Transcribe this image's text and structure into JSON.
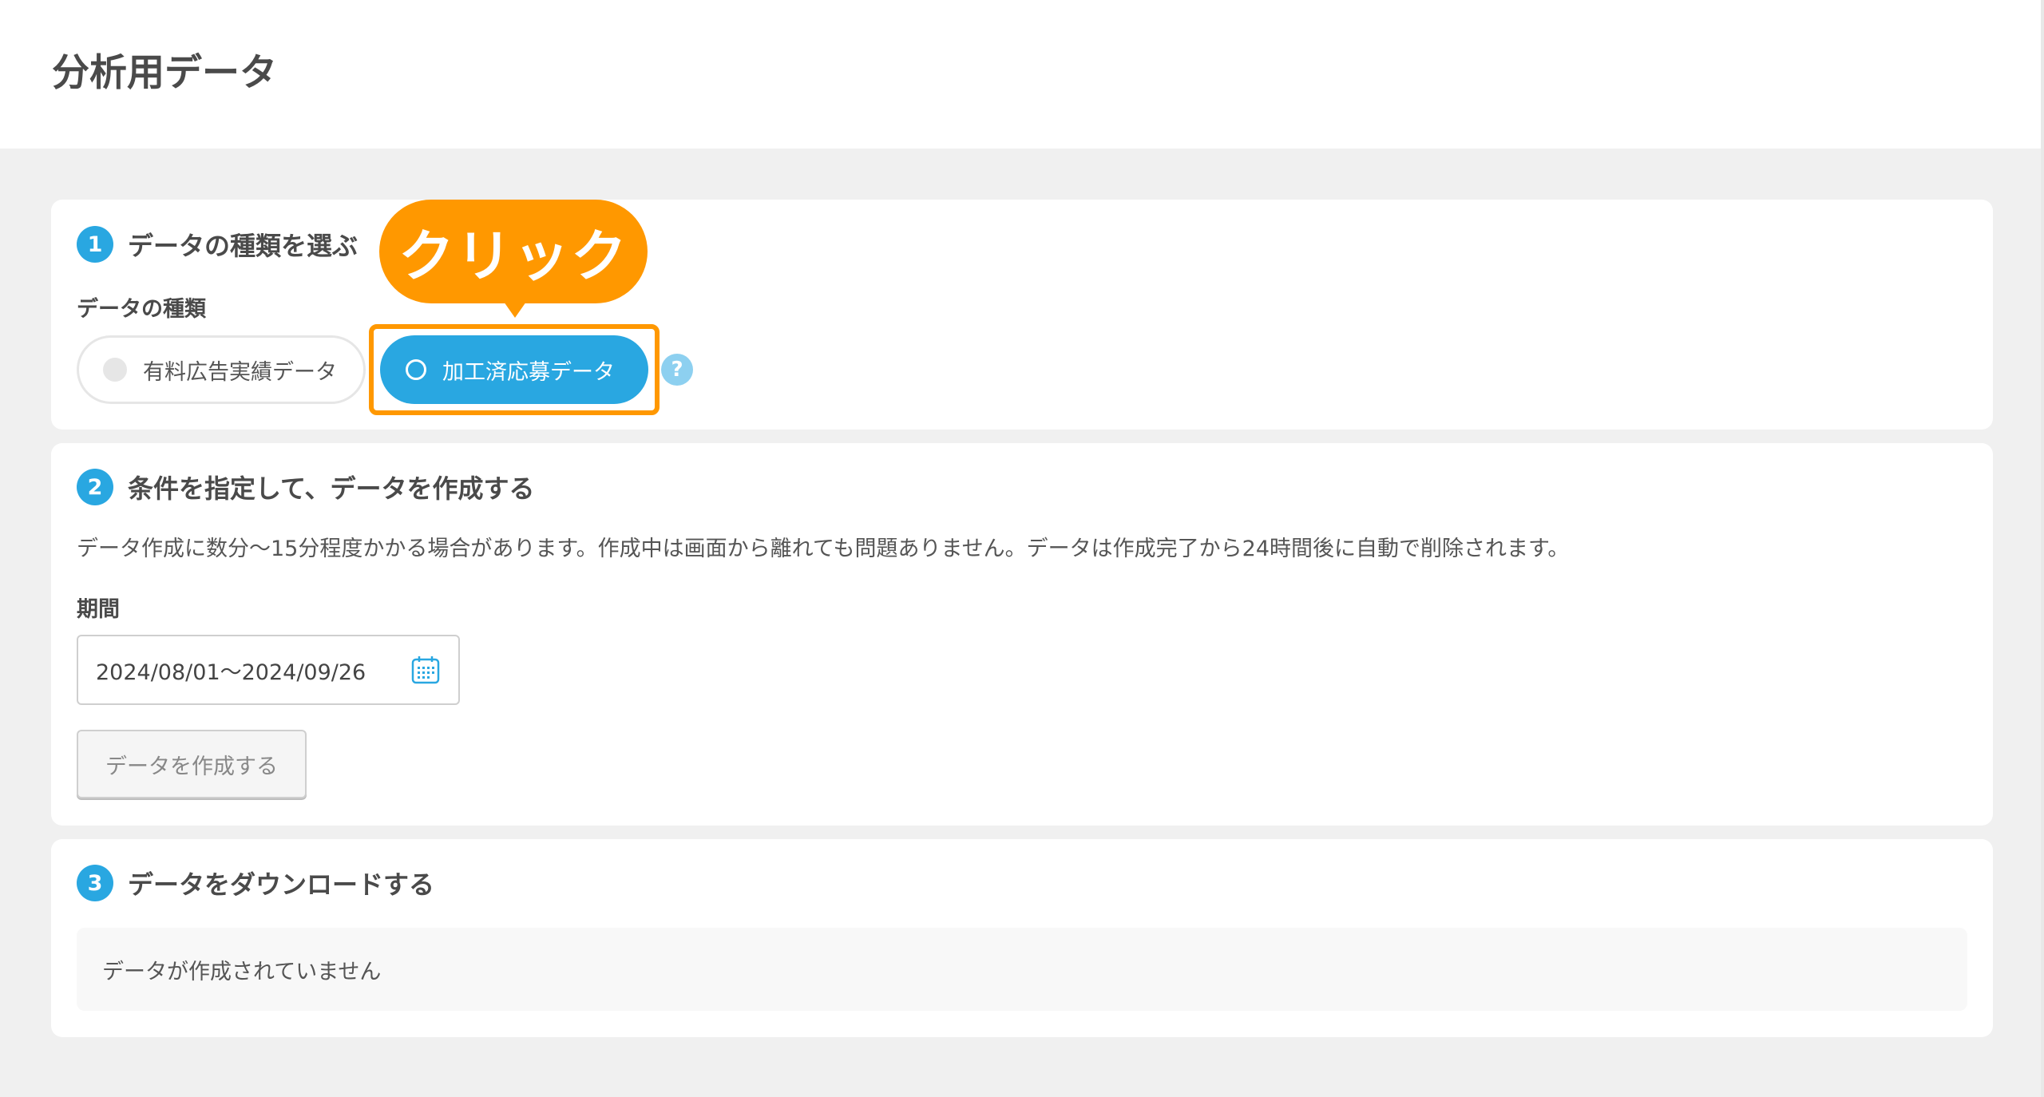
{
  "page": {
    "title": "分析用データ"
  },
  "colors": {
    "accent": "#29a7e1",
    "callout": "#ff9800",
    "background": "#f0f0f0"
  },
  "step1": {
    "number": "1",
    "title": "データの種類を選ぶ",
    "field_label": "データの種類",
    "options": [
      {
        "label": "有料広告実績データ",
        "selected": false
      },
      {
        "label": "加工済応募データ",
        "selected": true
      }
    ],
    "help_icon": "?",
    "callout": "クリック"
  },
  "step2": {
    "number": "2",
    "title": "条件を指定して、データを作成する",
    "description": "データ作成に数分〜15分程度かかる場合があります。作成中は画面から離れても問題ありません。データは作成完了から24時間後に自動で削除されます。",
    "period_label": "期間",
    "period_value": "2024/08/01〜2024/09/26",
    "calendar_icon": "calendar-icon",
    "create_button": "データを作成する"
  },
  "step3": {
    "number": "3",
    "title": "データをダウンロードする",
    "empty_message": "データが作成されていません"
  }
}
